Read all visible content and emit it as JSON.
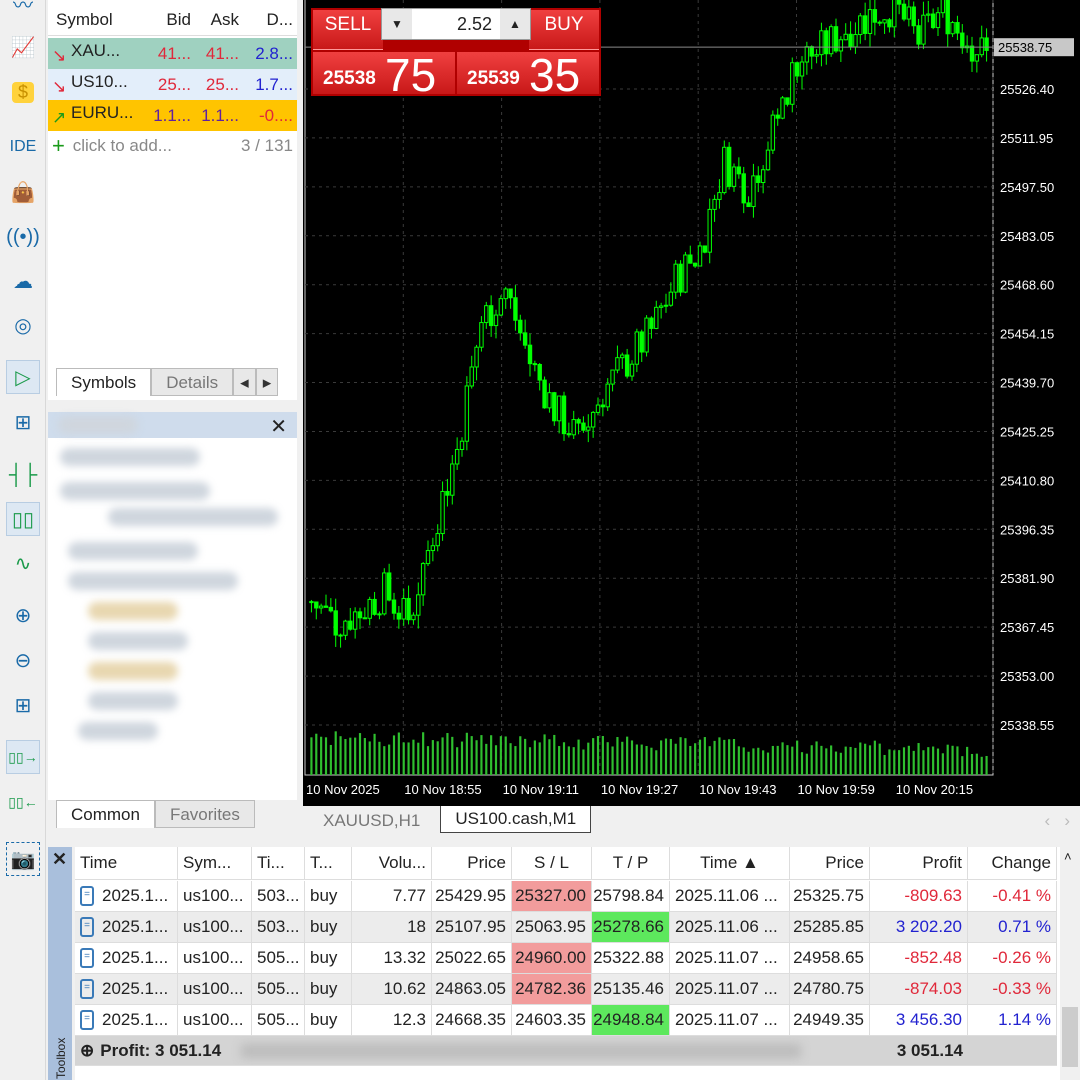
{
  "market_watch": {
    "headers": [
      "Symbol",
      "Bid",
      "Ask",
      "D..."
    ],
    "rows": [
      {
        "arrow": "↘",
        "symbol": "XAU...",
        "bid": "41...",
        "ask": "41...",
        "d": "2.8...",
        "bg": "#9fd1c0",
        "arrow_color": "#e0283a",
        "bid_color": "#e0283a",
        "d_color": "#2222d0"
      },
      {
        "arrow": "↘",
        "symbol": "US10...",
        "bid": "25...",
        "ask": "25...",
        "d": "1.7...",
        "bg": "#e3eefa",
        "arrow_color": "#e0283a",
        "bid_color": "#e0283a",
        "d_color": "#2222d0"
      },
      {
        "arrow": "↗",
        "symbol": "EURU...",
        "bid": "1.1...",
        "ask": "1.1...",
        "d": "-0....",
        "bg": "#ffc400",
        "arrow_color": "#1a9a1a",
        "bid_color": "#6020a0",
        "d_color": "#e0283a"
      }
    ],
    "add_label": "click to add...",
    "count": "3 / 131",
    "tabs": [
      "Symbols",
      "Details"
    ]
  },
  "navigator": {
    "tabs": [
      "Common",
      "Favorites"
    ]
  },
  "left_toolbar": {
    "ide_label": "IDE"
  },
  "trade_panel": {
    "sell_label": "SELL",
    "buy_label": "BUY",
    "volume": "2.52",
    "sell_prefix": "25538",
    "sell_big": "75",
    "buy_prefix": "25539",
    "buy_big": "35"
  },
  "chart_tabs": [
    "XAUUSD,H1",
    "US100.cash,M1"
  ],
  "chart_data": {
    "type": "candlestick",
    "symbol": "US100.cash",
    "timeframe": "M1",
    "price_ticks": [
      "25526.40",
      "25511.95",
      "25497.50",
      "25483.05",
      "25468.60",
      "25454.15",
      "25439.70",
      "25425.25",
      "25410.80",
      "25396.35",
      "25381.90",
      "25367.45",
      "25353.00",
      "25338.55"
    ],
    "current_price": "25538.75",
    "time_ticks": [
      "10 Nov 2025",
      "10 Nov 18:55",
      "10 Nov 19:11",
      "10 Nov 19:27",
      "10 Nov 19:43",
      "10 Nov 19:59",
      "10 Nov 20:15"
    ],
    "ylim": [
      25338.55,
      25555
    ],
    "close_path": [
      25375,
      25369,
      25372,
      25378,
      25369,
      25396,
      25420,
      25458,
      25467,
      25446,
      25432,
      25423,
      25437,
      25446,
      25455,
      25470,
      25479,
      25505,
      25497,
      25514,
      25535,
      25538,
      25544,
      25548,
      25551,
      25541,
      25550,
      25541,
      25535
    ],
    "colors": {
      "bull": "#00ff00",
      "bear": "#00ff00",
      "background": "#000000",
      "grid": "#3a3a3a"
    }
  },
  "toolbox": {
    "headers": [
      "Time",
      "Sym...",
      "Ti...",
      "T...",
      "Volu...",
      "Price",
      "S / L",
      "T / P",
      "Time ▲",
      "Price",
      "Profit",
      "Change"
    ],
    "rows": [
      [
        "2025.1...",
        "us100...",
        "503...",
        "buy",
        "7.77",
        "25429.95",
        "25327.00",
        "25798.84",
        "2025.11.06 ...",
        "25325.75",
        "-809.63",
        "-0.41 %"
      ],
      [
        "2025.1...",
        "us100...",
        "503...",
        "buy",
        "18",
        "25107.95",
        "25063.95",
        "25278.66",
        "2025.11.06 ...",
        "25285.85",
        "3 202.20",
        "0.71 %"
      ],
      [
        "2025.1...",
        "us100...",
        "505...",
        "buy",
        "13.32",
        "25022.65",
        "24960.00",
        "25322.88",
        "2025.11.07 ...",
        "24958.65",
        "-852.48",
        "-0.26 %"
      ],
      [
        "2025.1...",
        "us100...",
        "505...",
        "buy",
        "10.62",
        "24863.05",
        "24782.36",
        "25135.46",
        "2025.11.07 ...",
        "24780.75",
        "-874.03",
        "-0.33 %"
      ],
      [
        "2025.1...",
        "us100...",
        "505...",
        "buy",
        "12.3",
        "24668.35",
        "24603.35",
        "24948.84",
        "2025.11.07 ...",
        "24949.35",
        "3 456.30",
        "1.14 %"
      ]
    ],
    "sl_highlight": [
      "red",
      "none",
      "red",
      "red",
      "none"
    ],
    "tp_highlight": [
      "none",
      "green",
      "none",
      "none",
      "green"
    ],
    "profit_label": "Profit: 3 051.14",
    "profit_total": "3 051.14",
    "side_label": "Toolbox"
  }
}
